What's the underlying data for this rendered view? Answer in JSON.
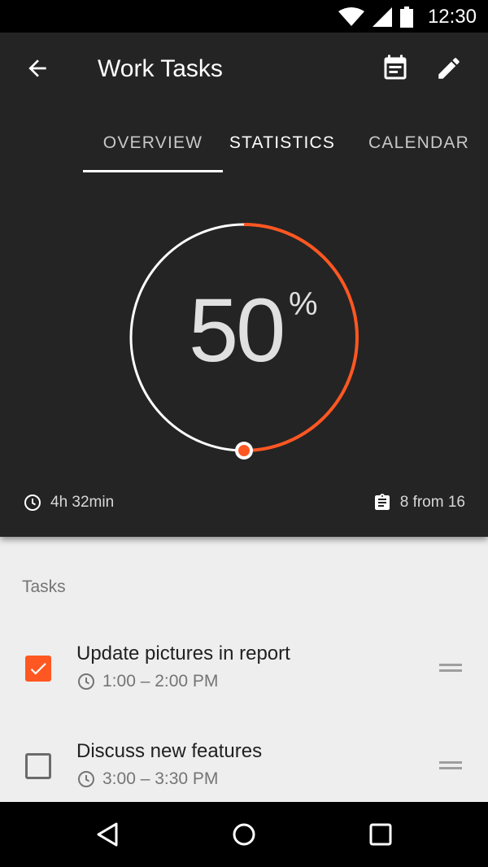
{
  "status_bar": {
    "time": "12:30"
  },
  "toolbar": {
    "title": "Work Tasks"
  },
  "tabs": [
    {
      "label": "OVERVIEW"
    },
    {
      "label": "STATISTICS"
    },
    {
      "label": "CALENDAR"
    }
  ],
  "progress": {
    "value": "50",
    "sign": "%",
    "fraction": 0.5
  },
  "stats": {
    "time_spent": "4h 32min",
    "tasks_done": "8 from 16"
  },
  "tasks_section": {
    "title": "Tasks",
    "items": [
      {
        "title": "Update pictures in report",
        "time": "1:00 – 2:00 PM",
        "done": true
      },
      {
        "title": "Discuss new features",
        "time": "3:00 – 3:30 PM",
        "done": false
      }
    ]
  },
  "colors": {
    "accent": "#ff5722",
    "header_bg": "#242424",
    "list_bg": "#eeeeee"
  }
}
